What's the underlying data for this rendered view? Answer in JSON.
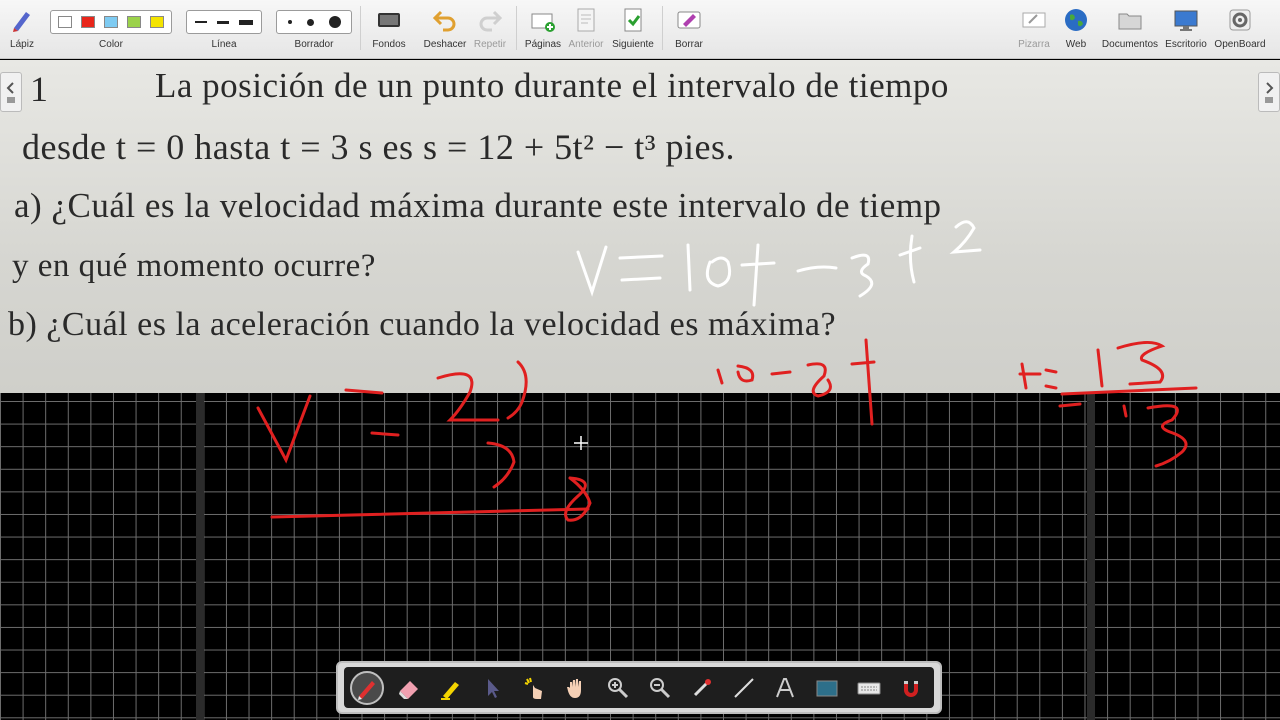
{
  "toolbar": {
    "pencil_label": "Lápiz",
    "color_label": "Color",
    "line_label": "Línea",
    "eraser_label": "Borrador",
    "backgrounds_label": "Fondos",
    "undo_label": "Deshacer",
    "redo_label": "Repetir",
    "pages_label": "Páginas",
    "previous_label": "Anterior",
    "next_label": "Siguiente",
    "clear_label": "Borrar",
    "board_label": "Pizarra",
    "web_label": "Web",
    "documents_label": "Documentos",
    "desktop_label": "Escritorio",
    "openboard_label": "OpenBoard",
    "colors": [
      "#ffffff",
      "#e8261b",
      "#7ecbf2",
      "#9bd24a",
      "#f4e400"
    ]
  },
  "document": {
    "problem_number": "1",
    "line1": "La posición de un punto durante el intervalo de tiempo",
    "line2": "desde t = 0 hasta t = 3 s es s = 12 + 5t² − t³ pies.",
    "line3": "a)  ¿Cuál es la velocidad máxima durante este intervalo de tiemp",
    "line4": "y en qué momento ocurre?",
    "line5": "b)  ¿Cuál es la aceleración cuando la velocidad es máxima?"
  },
  "ink": {
    "stroke_white": "#ffffff",
    "stroke_red": "#e02020"
  },
  "stylus_tools": [
    "pen-icon",
    "eraser-icon",
    "highlighter-icon",
    "pointer-icon",
    "laser-icon",
    "hand-icon",
    "zoom-in-icon",
    "zoom-out-icon",
    "capture-icon",
    "line-icon",
    "text-icon",
    "background-icon",
    "keyboard-icon",
    "magnet-icon"
  ]
}
